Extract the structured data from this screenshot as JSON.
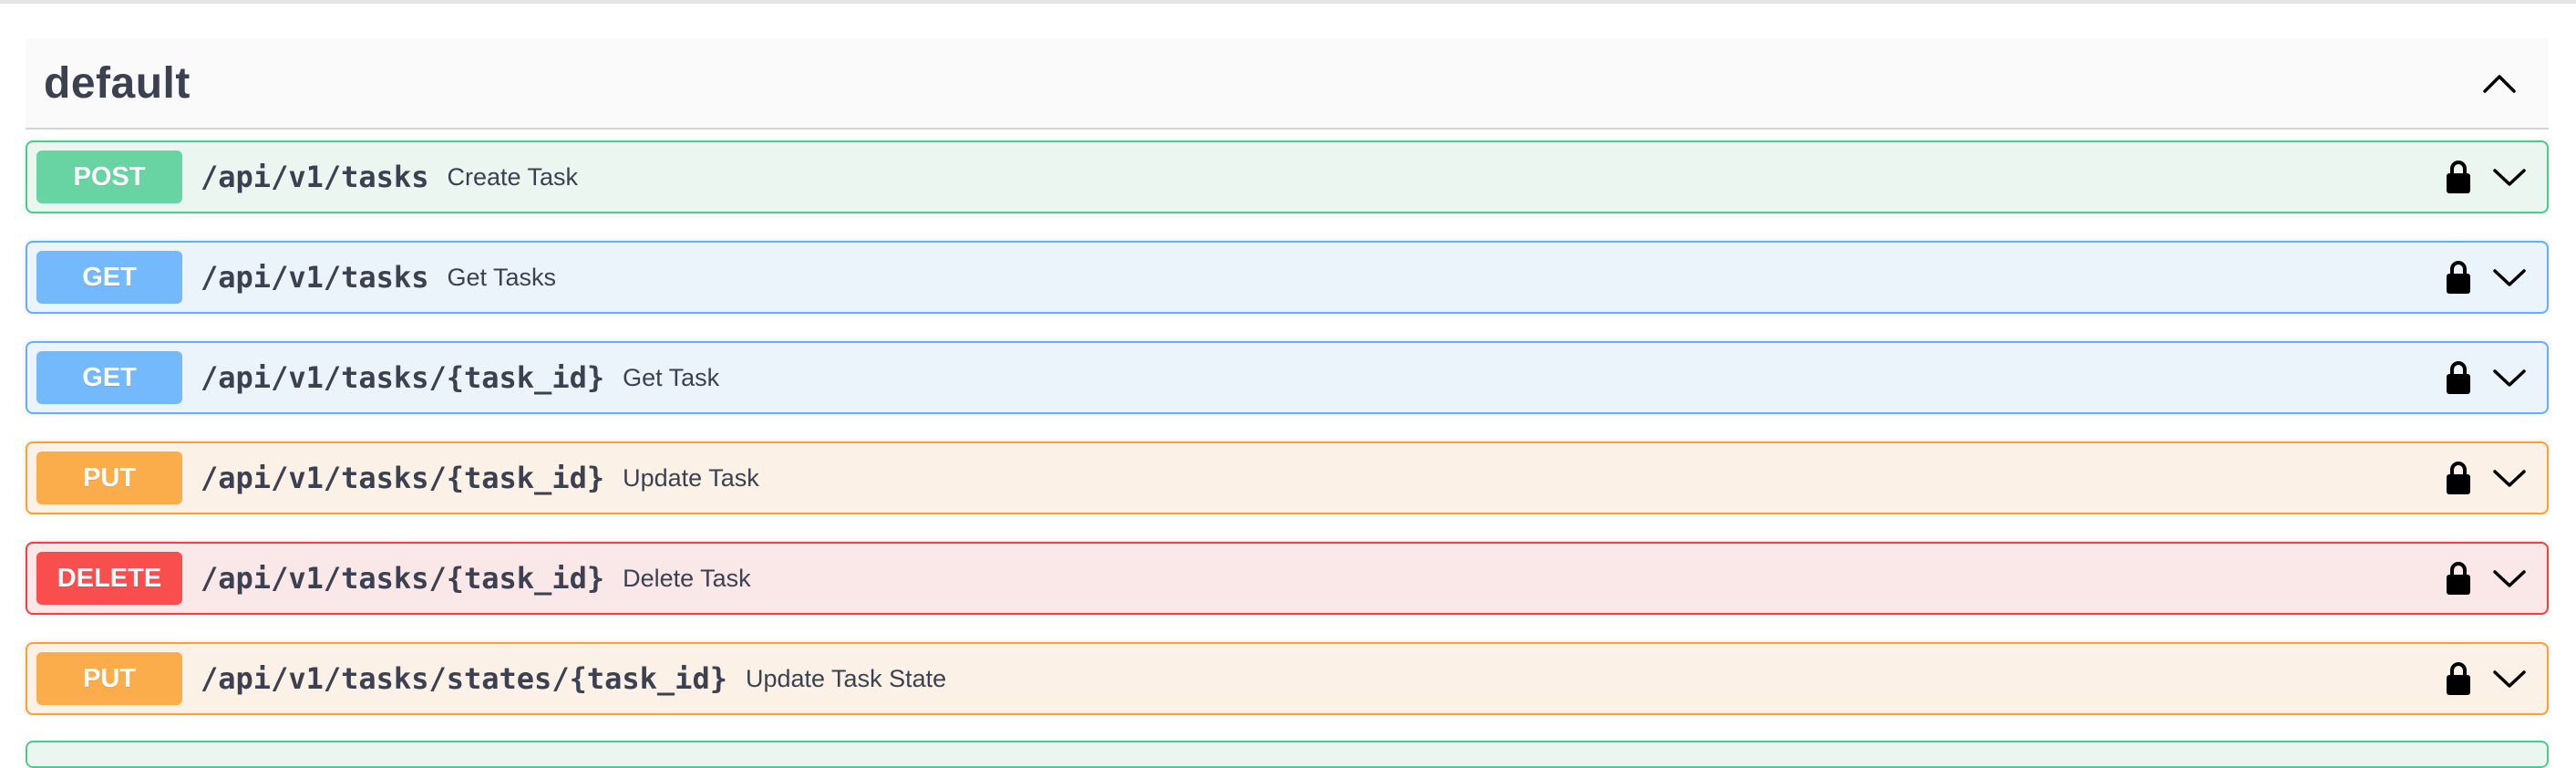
{
  "section": {
    "title": "default",
    "collapse_icon": "chevron-up-icon"
  },
  "operations": [
    {
      "method": "POST",
      "path": "/api/v1/tasks",
      "summary": "Create Task",
      "color": "#49cc90"
    },
    {
      "method": "GET",
      "path": "/api/v1/tasks",
      "summary": "Get Tasks",
      "color": "#61affe"
    },
    {
      "method": "GET",
      "path": "/api/v1/tasks/{task_id}",
      "summary": "Get Task",
      "color": "#61affe"
    },
    {
      "method": "PUT",
      "path": "/api/v1/tasks/{task_id}",
      "summary": "Update Task",
      "color": "#fca130"
    },
    {
      "method": "DELETE",
      "path": "/api/v1/tasks/{task_id}",
      "summary": "Delete Task",
      "color": "#f93e3e"
    },
    {
      "method": "PUT",
      "path": "/api/v1/tasks/states/{task_id}",
      "summary": "Update Task State",
      "color": "#fca130"
    }
  ],
  "icons": {
    "lock": "lock-icon",
    "expand": "chevron-down-icon"
  }
}
